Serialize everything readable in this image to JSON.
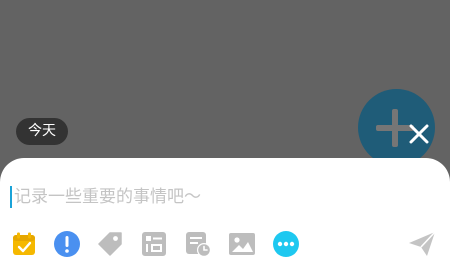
{
  "timeline": {
    "date_badge": "今天"
  },
  "composer": {
    "placeholder": "记录一些重要的事情吧～",
    "value": ""
  },
  "toolbar": {
    "items": [
      {
        "icon": "calendar-icon",
        "color": "#f5b800"
      },
      {
        "icon": "priority-alert-icon",
        "color": "#4a90f0"
      },
      {
        "icon": "tag-icon",
        "color": "#bdbdbd"
      },
      {
        "icon": "checklist-icon",
        "color": "#bdbdbd"
      },
      {
        "icon": "reminder-clock-icon",
        "color": "#bdbdbd"
      },
      {
        "icon": "image-icon",
        "color": "#bdbdbd"
      },
      {
        "icon": "more-icon",
        "color": "#1ec8f0"
      },
      {
        "icon": "send-icon",
        "color": "#c4c4c4"
      }
    ]
  },
  "colors": {
    "overlay": "#636363",
    "fab": "#1f5c78",
    "sheet": "#ffffff"
  }
}
